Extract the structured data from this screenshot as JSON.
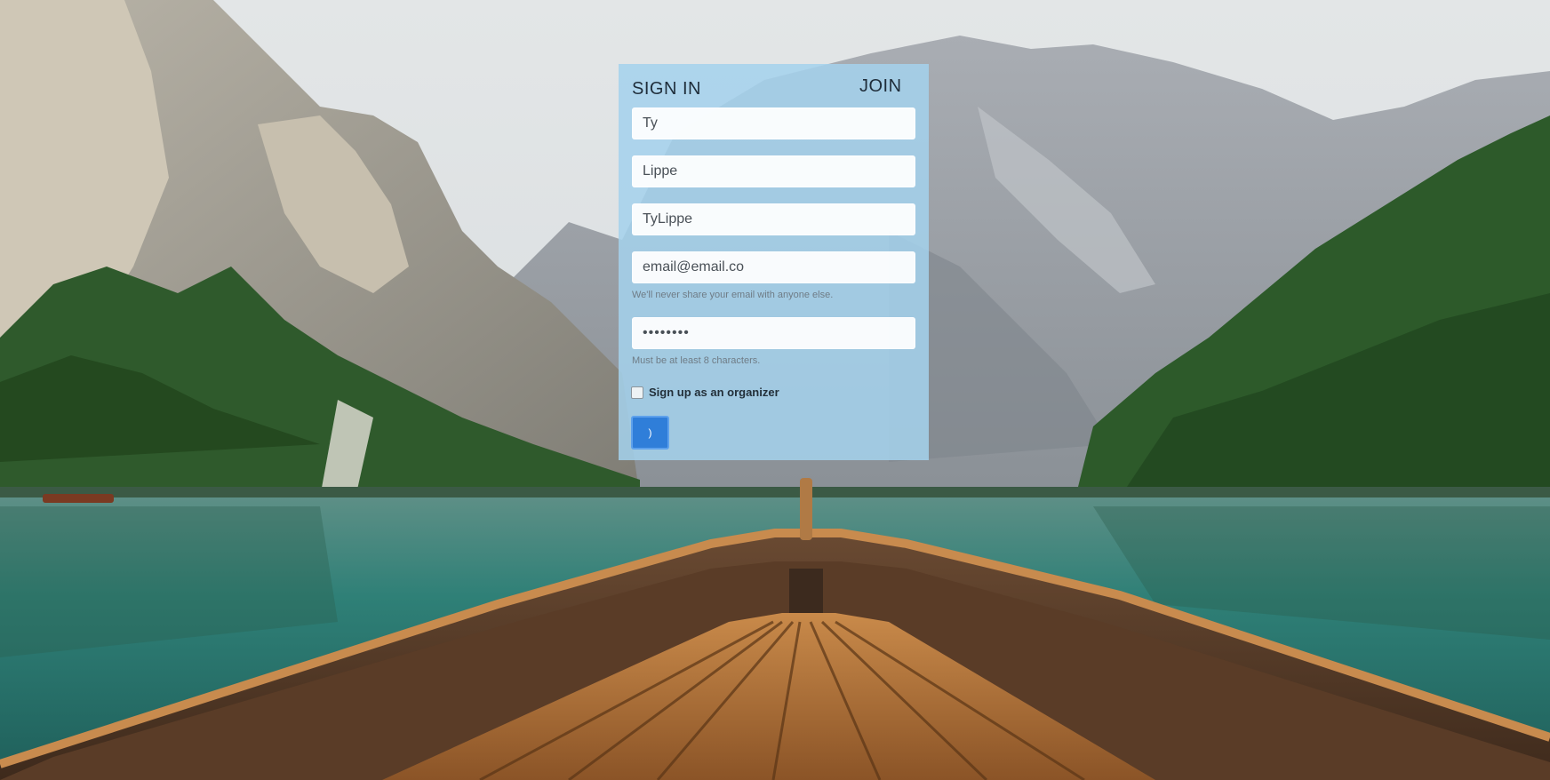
{
  "tabs": {
    "sign_in": "SIGN IN",
    "join": "JOIN"
  },
  "form": {
    "first_name": "Ty",
    "last_name": "Lippe",
    "username": "TyLippe",
    "email": "email@email.co",
    "email_help": "We'll never share your email with anyone else.",
    "password": "••••••••",
    "password_help": "Must be at least 8 characters.",
    "organizer_label": "Sign up as an organizer",
    "organizer_checked": false,
    "submit_label": ")"
  },
  "colors": {
    "panel": "#a4d2ec",
    "submit": "#2f7ed9",
    "water": "#2e7f7a",
    "boat": "#b5743a"
  }
}
